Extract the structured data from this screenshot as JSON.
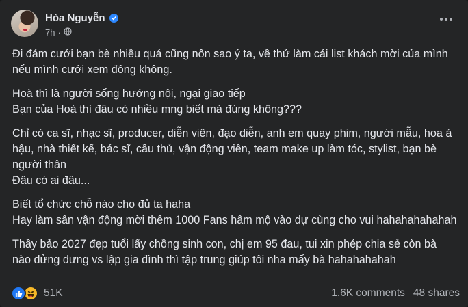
{
  "post": {
    "author": "Hòa Nguyễn",
    "time": "7h",
    "separator": "·",
    "paragraphs": [
      "Đi đám cưới bạn bè nhiều quá cũng nôn sao ý ta, về thử làm cái list khách mời của mình nếu mình cưới xem đông không.",
      "Hoà thì là người sống hướng nội, ngại giao tiếp\nBạn của Hoà thì đâu có nhiều mng biết mà đúng không???",
      "Chỉ có ca sĩ, nhạc sĩ, producer, diễn viên, đạo diễn, anh em quay phim, người mẫu, hoa á hậu, nhà thiết kế, bác sĩ, cầu thủ, vận động viên, team make up làm tóc, stylist, bạn bè người thân\nĐâu có ai đâu...",
      "Biết tổ chức chỗ nào cho đủ ta haha\nHay làm sân vận động mời thêm 1000 Fans hâm mộ vào dự cùng cho vui hahahahahahah",
      "Thầy bảo 2027 đẹp tuổi lấy chồng sinh con, chị em 95 đau, tui xin phép chia sẻ còn bà nào dửng dưng vs lập gia đình thì tập trung giúp tôi nha mấy bà hahahahahah"
    ]
  },
  "footer": {
    "reaction_count": "51K",
    "comments": "1.6K comments",
    "shares": "48 shares"
  },
  "colors": {
    "background": "#242526",
    "text": "#e4e6eb",
    "secondary": "#b0b3b8",
    "accent": "#2d88ff"
  },
  "icons": [
    "verified-badge-icon",
    "globe-icon",
    "more-options-icon",
    "like-reaction-icon",
    "haha-reaction-icon"
  ]
}
